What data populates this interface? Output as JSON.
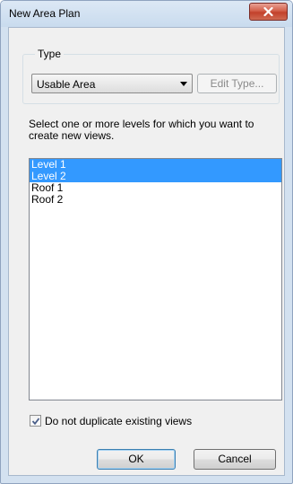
{
  "window": {
    "title": "New Area Plan",
    "close_icon": "close-x-icon"
  },
  "type_group": {
    "label": "Type",
    "dropdown": {
      "selected": "Usable Area",
      "icon": "chevron-down-icon"
    },
    "edit_type_label": "Edit Type..."
  },
  "instructions": "Select one or more levels for which you want to create new views.",
  "levels": {
    "items": [
      {
        "label": "Level 1",
        "selected": true
      },
      {
        "label": "Level 2",
        "selected": true
      },
      {
        "label": "Roof 1",
        "selected": false
      },
      {
        "label": "Roof 2",
        "selected": false
      }
    ]
  },
  "options": {
    "no_duplicate_label": "Do not duplicate existing views",
    "no_duplicate_checked": true
  },
  "buttons": {
    "ok_label": "OK",
    "cancel_label": "Cancel"
  },
  "colors": {
    "selection": "#3399ff",
    "close_button": "#c2412b"
  }
}
